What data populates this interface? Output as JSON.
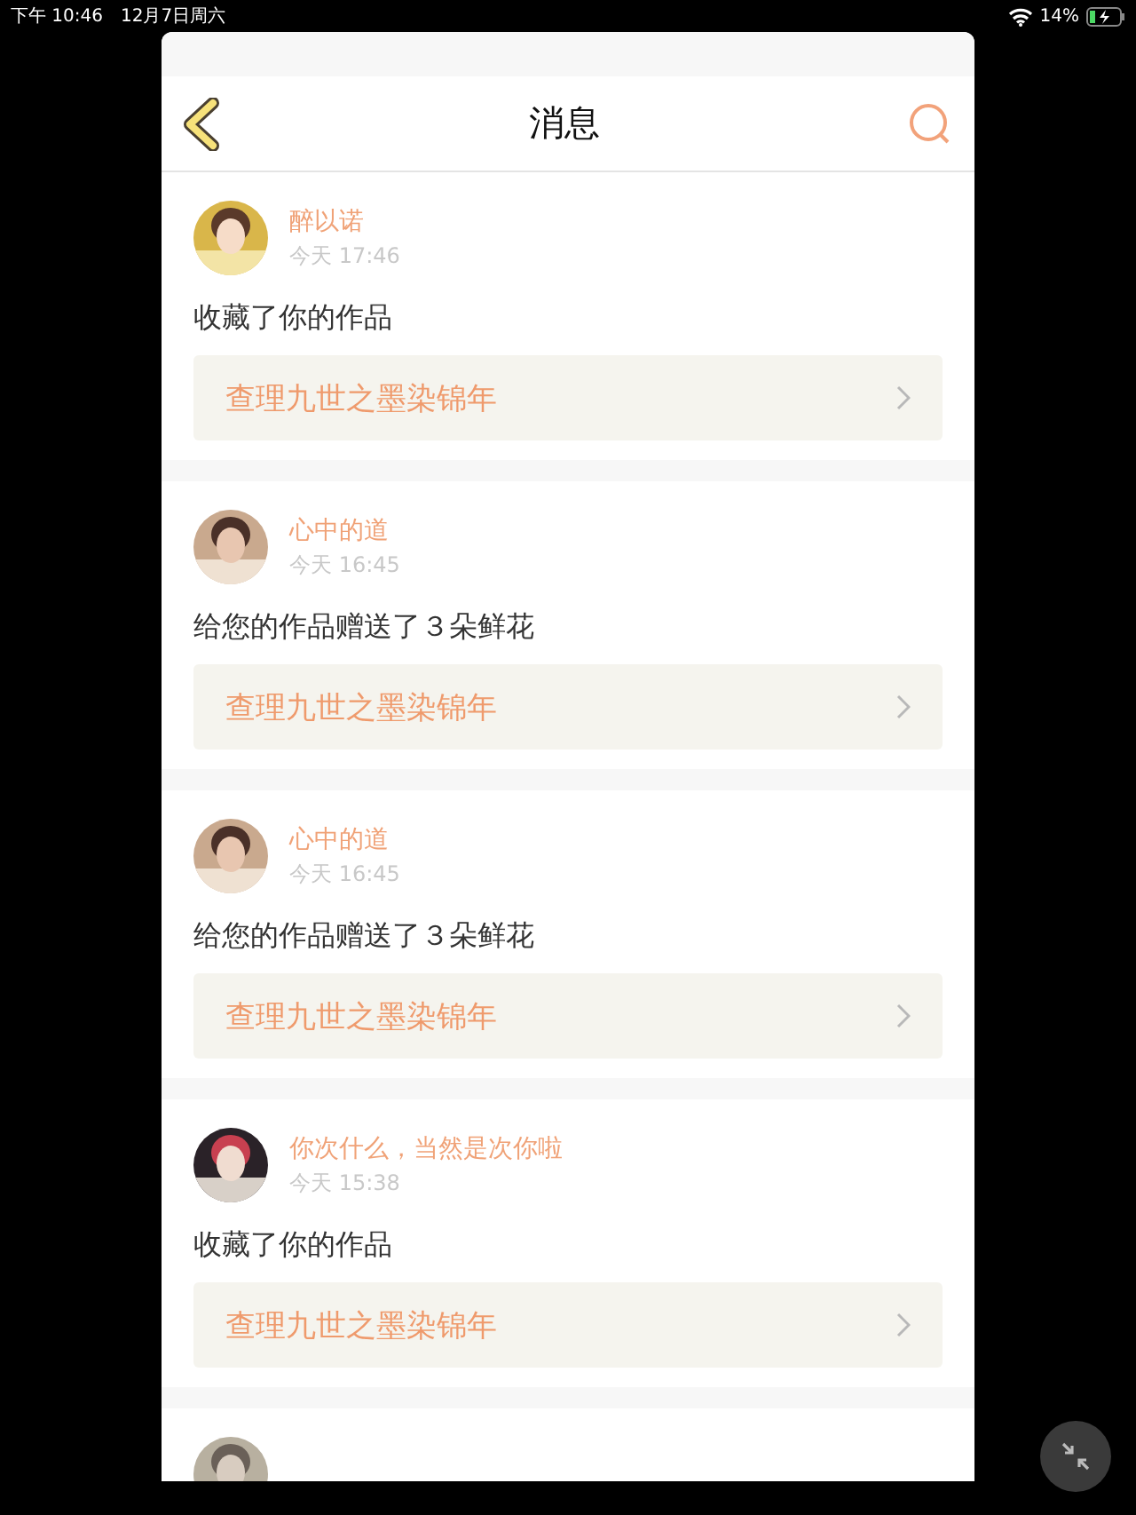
{
  "status_bar": {
    "time": "下午 10:46",
    "date": "12月7日周六",
    "battery": "14%"
  },
  "header": {
    "title": "消息"
  },
  "messages": [
    {
      "name": "醉以诺",
      "time": "今天 17:46",
      "text": "收藏了你的作品",
      "work": "查理九世之墨染锦年",
      "avatar": {
        "kind": "picture"
      }
    },
    {
      "name": "心中的道",
      "time": "今天 16:45",
      "text": "给您的作品赠送了３朵鲜花",
      "work": "查理九世之墨染锦年",
      "avatar": {
        "kind": "picture"
      }
    },
    {
      "name": "心中的道",
      "time": "今天 16:45",
      "text": "给您的作品赠送了３朵鲜花",
      "work": "查理九世之墨染锦年",
      "avatar": {
        "kind": "picture"
      }
    },
    {
      "name": "你次什么，当然是次你啦",
      "time": "今天 15:38",
      "text": "收藏了你的作品",
      "work": "查理九世之墨染锦年",
      "avatar": {
        "kind": "picture"
      }
    },
    {
      "avatar": {
        "kind": "picture"
      }
    }
  ]
}
